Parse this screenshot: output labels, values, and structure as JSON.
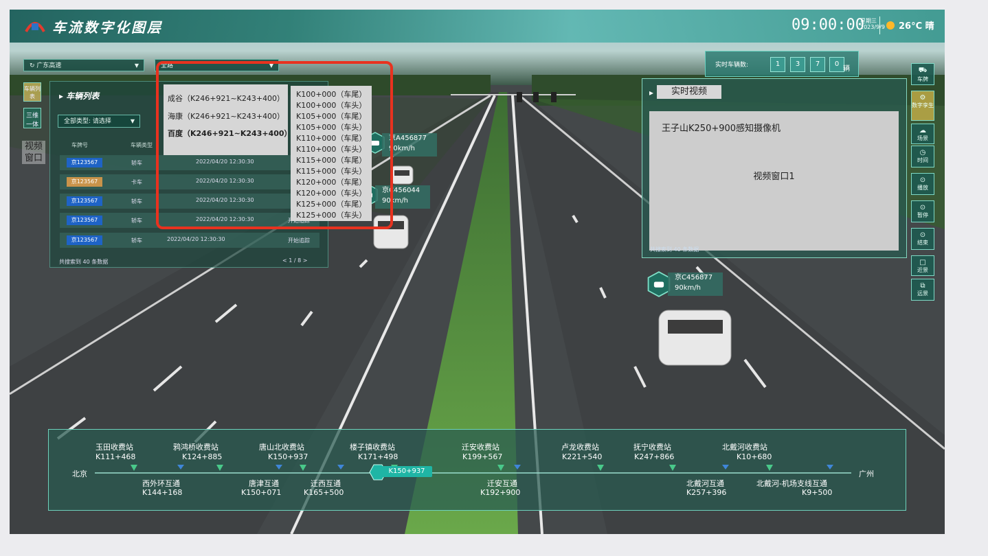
{
  "header": {
    "title": "车流数字化图层",
    "time": "09:00:00",
    "weekday": "星期三",
    "date": "2023/9/9",
    "weather": "26°C 晴"
  },
  "filters": {
    "region": "广东高速",
    "road": "全路"
  },
  "left_tabs": [
    "车辆列表",
    "三维一体",
    "视频窗口"
  ],
  "vehicle_list": {
    "title": "车辆列表",
    "filter": "全部类型: 请选择",
    "headers": {
      "plate": "车牌号",
      "type": "车辆类型"
    },
    "rows": [
      {
        "plate": "京123567",
        "type": "轿车",
        "time": "2022/04/20 12:30:30",
        "action": ""
      },
      {
        "plate": "京123567",
        "type": "卡车",
        "time": "2022/04/20 12:30:30",
        "action": ""
      },
      {
        "plate": "京123567",
        "type": "轿车",
        "time": "2022/04/20 12:30:30",
        "action": ""
      },
      {
        "plate": "京123567",
        "type": "轿车",
        "time": "2022/04/20 12:30:30",
        "action": "开始追踪"
      },
      {
        "plate": "京123567",
        "type": "轿车",
        "time": "2022/04/20 12:30:30",
        "action": "开始追踪"
      }
    ],
    "footer": "共搜索到 40 条数据",
    "pager": "< 1 / 8 >"
  },
  "road_menu": {
    "items": [
      "成谷（K246+921~K243+400）",
      "海康（K246+921~K243+400）",
      "百度（K246+921~K243+400）"
    ],
    "selected_index": 2
  },
  "km_menu": {
    "items": [
      "K100+000（车尾）",
      "K100+000（车头）",
      "K105+000（车尾）",
      "K105+000（车头）",
      "K110+000（车尾）",
      "K110+000（车头）",
      "K115+000（车尾）",
      "K115+000（车头）",
      "K120+000（车尾）",
      "K120+000（车头）",
      "K125+000（车尾）",
      "K125+000（车头）"
    ]
  },
  "realtime_count": {
    "label": "实时车辆数:",
    "digits": [
      "1",
      "3",
      "7",
      "0"
    ],
    "unit": "辆"
  },
  "right_nav": [
    {
      "icon": "car-icon",
      "label": "车牌",
      "active": false
    },
    {
      "icon": "gear-icon",
      "label": "数字孪生",
      "active": true
    },
    {
      "icon": "cloud-icon",
      "label": "场景",
      "active": false
    },
    {
      "icon": "clock-icon",
      "label": "时间",
      "active": false
    },
    {
      "icon": "play-icon",
      "label": "播放",
      "active": false
    },
    {
      "icon": "pause-icon",
      "label": "暂停",
      "active": false
    },
    {
      "icon": "stop-icon",
      "label": "结束",
      "active": false
    },
    {
      "icon": "near-view-icon",
      "label": "近景",
      "active": false
    },
    {
      "icon": "far-view-icon",
      "label": "远景",
      "active": false
    }
  ],
  "video": {
    "tab": "实时视频",
    "camera": "王子山K250+900感知摄像机",
    "window": "视频窗口1",
    "footer": "共搜索到 40 条数据"
  },
  "vehicle_tags": [
    {
      "plate": "京A456877",
      "speed": "90km/h"
    },
    {
      "plate": "京C456044",
      "speed": "90km/h"
    },
    {
      "plate": "京C456877",
      "speed": "90km/h"
    }
  ],
  "route": {
    "start": "北京",
    "end": "广州",
    "current_km": "K150+937",
    "top_stations": [
      {
        "name": "玉田收费站",
        "km": "K111+468"
      },
      {
        "name": "鸦鸿桥收费站",
        "km": "K124+885"
      },
      {
        "name": "唐山北收费站",
        "km": "K150+937"
      },
      {
        "name": "楼子镇收费站",
        "km": "K171+498"
      },
      {
        "name": "迁安收费站",
        "km": "K199+567"
      },
      {
        "name": "卢龙收费站",
        "km": "K221+540"
      },
      {
        "name": "抚宁收费站",
        "km": "K247+866"
      },
      {
        "name": "北戴河收费站",
        "km": "K10+680"
      }
    ],
    "bottom_stations": [
      {
        "name": "西外环互通",
        "km": "K144+168"
      },
      {
        "name": "唐津互通",
        "km": "K150+071"
      },
      {
        "name": "迁西互通",
        "km": "K165+500"
      },
      {
        "name": "迁安互通",
        "km": "K192+900"
      },
      {
        "name": "北戴河互通",
        "km": "K257+396"
      },
      {
        "name": "北戴河-机场支线互通",
        "km": "K9+500"
      }
    ]
  },
  "colors": {
    "highlight": "#e8321f",
    "accent": "#1fb5a5",
    "plate_blue": "#1e63c6",
    "plate_yellow": "#c9934a"
  }
}
